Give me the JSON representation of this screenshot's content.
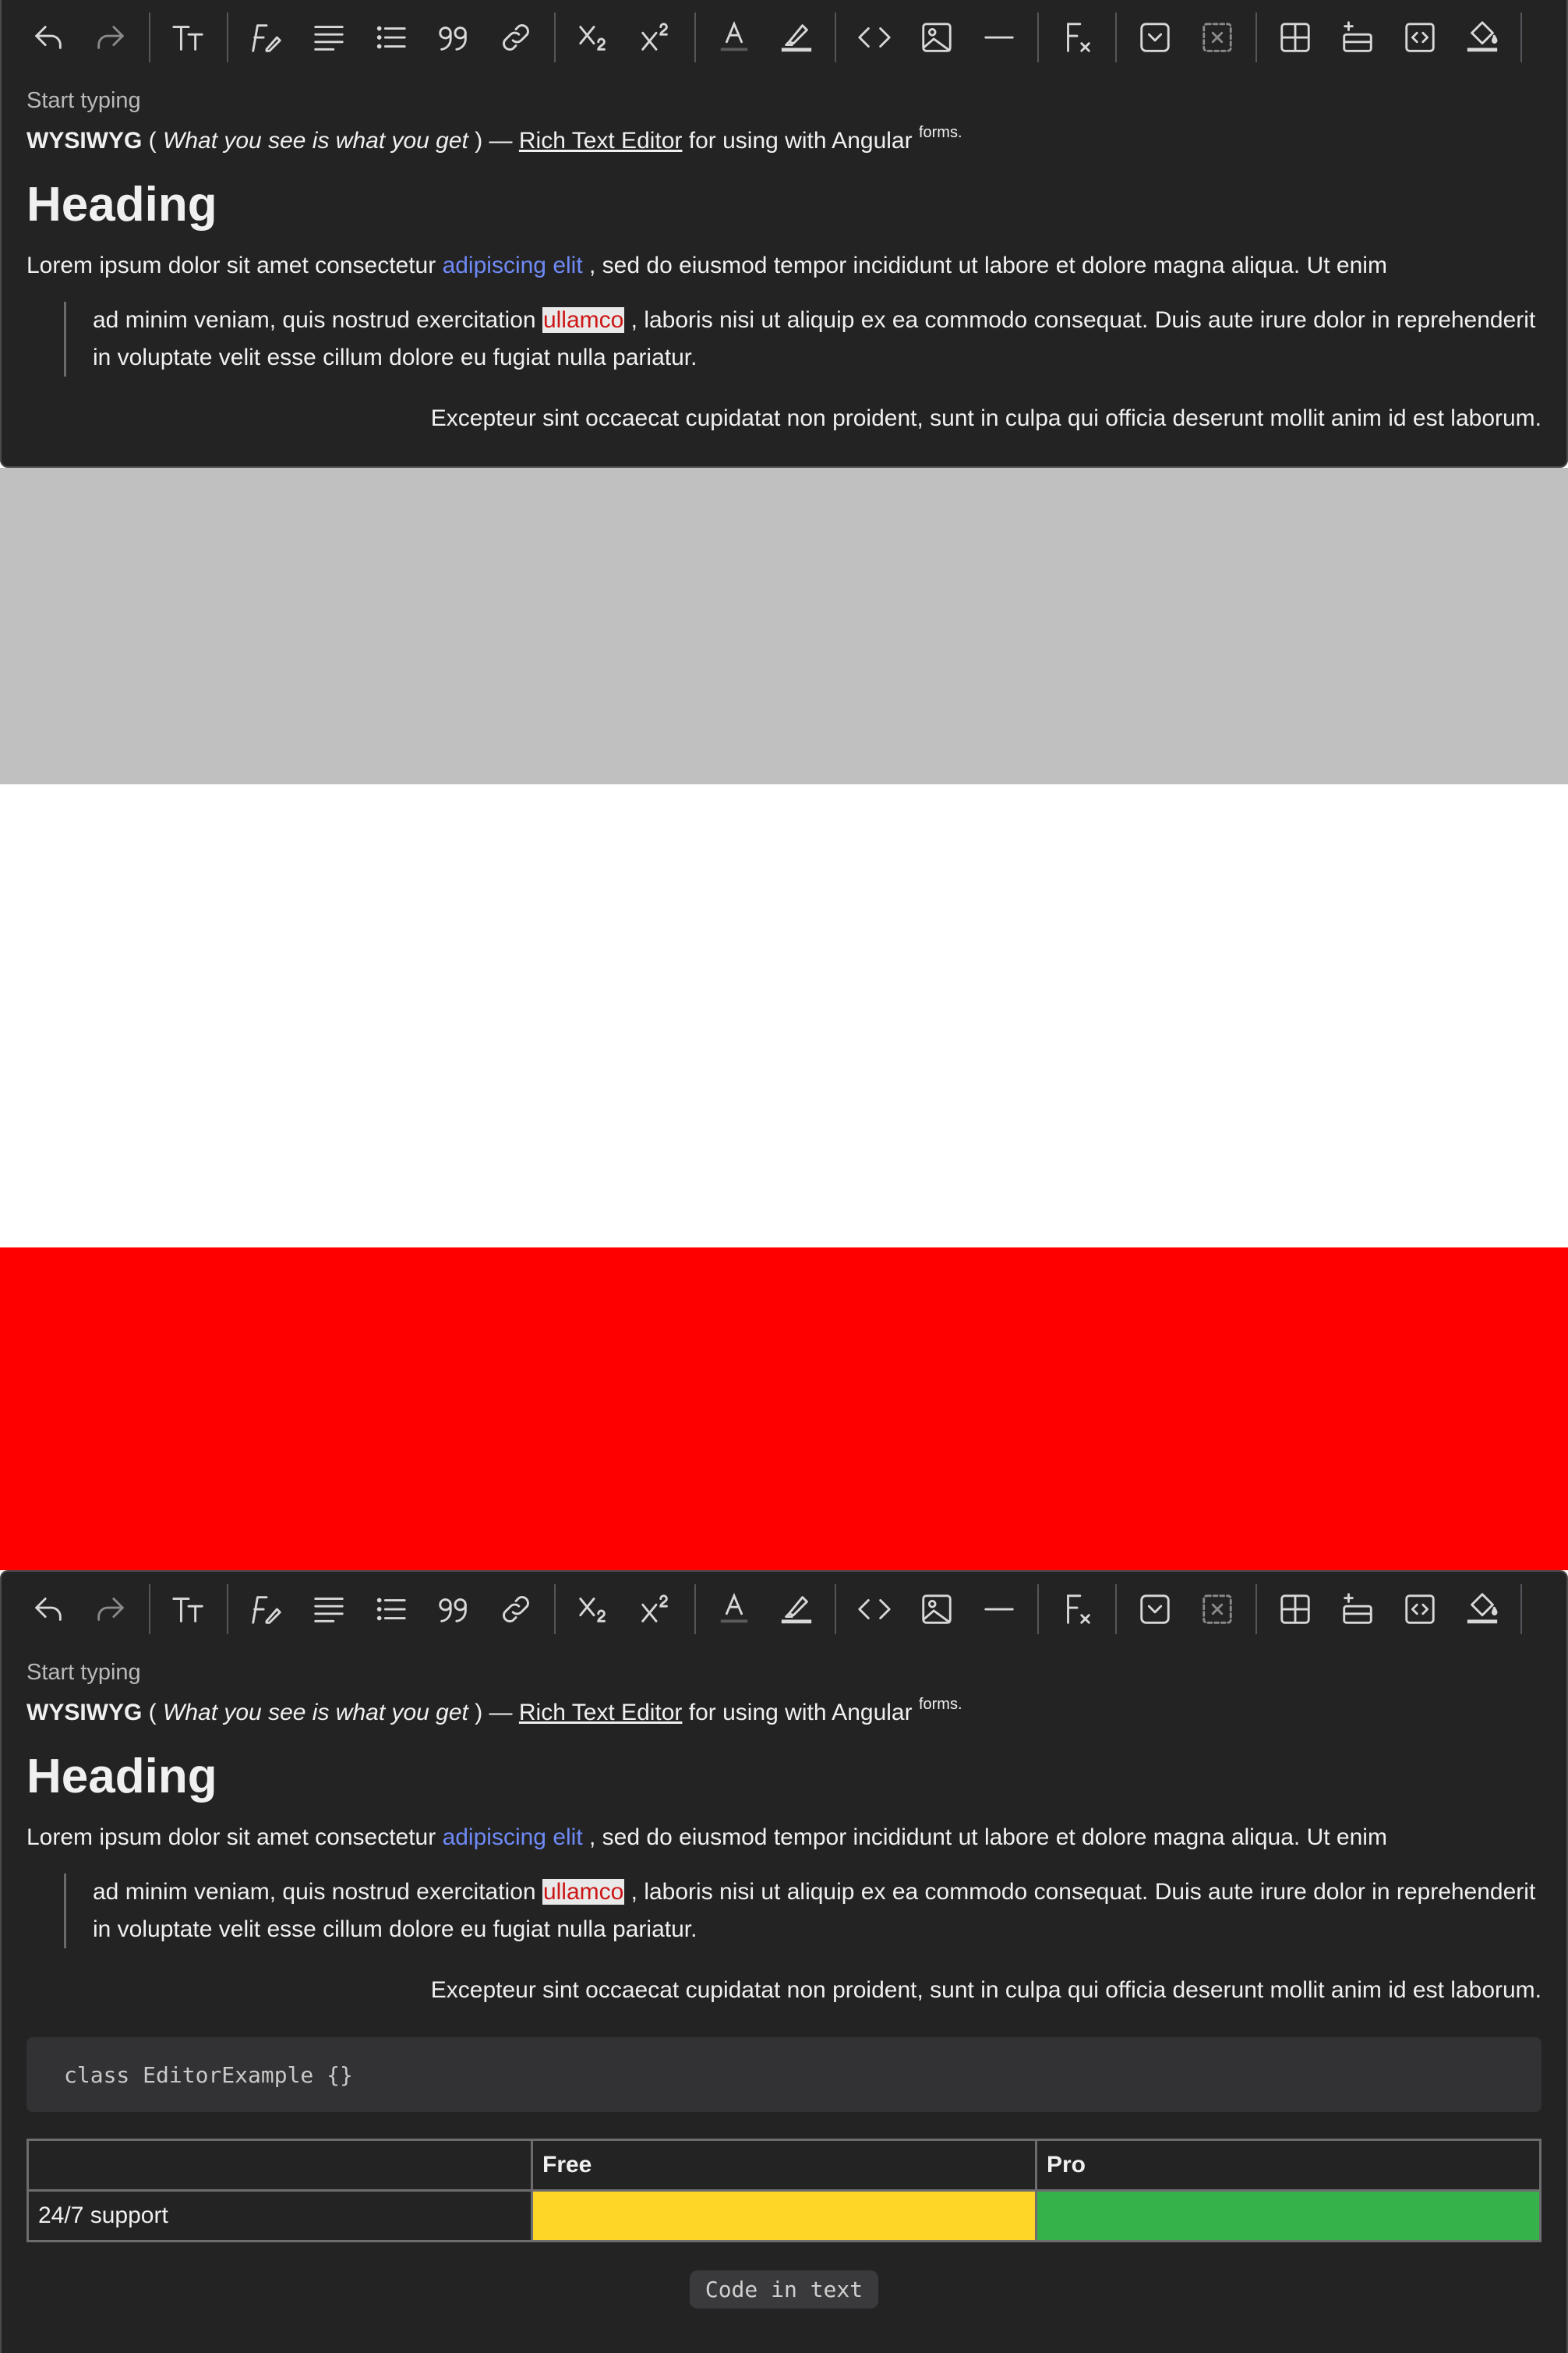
{
  "toolbar": {
    "buttons": [
      {
        "icon": "undo-icon"
      },
      {
        "icon": "redo-icon"
      },
      {
        "icon": "text-size-icon"
      },
      {
        "icon": "font-style-icon"
      },
      {
        "icon": "align-icon"
      },
      {
        "icon": "list-icon"
      },
      {
        "icon": "quote-icon"
      },
      {
        "icon": "link-icon"
      },
      {
        "icon": "subscript-icon"
      },
      {
        "icon": "superscript-icon"
      },
      {
        "icon": "text-color-icon"
      },
      {
        "icon": "highlight-icon"
      },
      {
        "icon": "code-icon"
      },
      {
        "icon": "image-icon"
      },
      {
        "icon": "horizontal-rule-icon"
      },
      {
        "icon": "clear-format-icon"
      },
      {
        "icon": "dropdown-icon"
      },
      {
        "icon": "remove-field-icon"
      },
      {
        "icon": "table-icon"
      },
      {
        "icon": "insert-row-icon"
      },
      {
        "icon": "embed-icon"
      },
      {
        "icon": "fill-color-icon"
      }
    ]
  },
  "editor": {
    "placeholder": "Start typing",
    "intro": {
      "wysiwyg": "WYSIWYG",
      "open_paren": " ( ",
      "italic": "What you see is what you get",
      "close": " ) — ",
      "link": "Rich Text Editor",
      "after_link": " for using with Angular ",
      "sup": "forms."
    },
    "heading": "Heading",
    "paragraph1": {
      "before": "Lorem ipsum dolor sit amet consectetur ",
      "link": "adipiscing elit",
      "after": " , sed do eiusmod tempor incididunt ut labore et dolore magna aliqua. Ut enim"
    },
    "quote": {
      "before": "ad minim veniam, quis nostrud exercitation ",
      "mark": "ullamco",
      "after": " , laboris nisi ut aliquip ex ea commodo consequat. Duis aute irure dolor in reprehenderit in voluptate velit esse cillum dolore eu fugiat nulla pariatur."
    },
    "paragraph2": "Excepteur sint occaecat cupidatat non proident, sunt in culpa qui officia deserunt mollit anim id est laborum.",
    "code_block": "class EditorExample {}",
    "table": {
      "headers": [
        "",
        "Free",
        "Pro"
      ],
      "row": [
        "24/7 support",
        "",
        ""
      ],
      "cell_colors": [
        "#fdd626",
        "#35b34a"
      ]
    },
    "inline_code": "Code in text"
  },
  "colors": {
    "editor_bg": "#232324",
    "band_gray": "#c0c0c0",
    "band_white": "#ffffff",
    "band_red": "#ff0000",
    "link_blue": "#6f8af5",
    "mark_text": "#cc1616"
  }
}
